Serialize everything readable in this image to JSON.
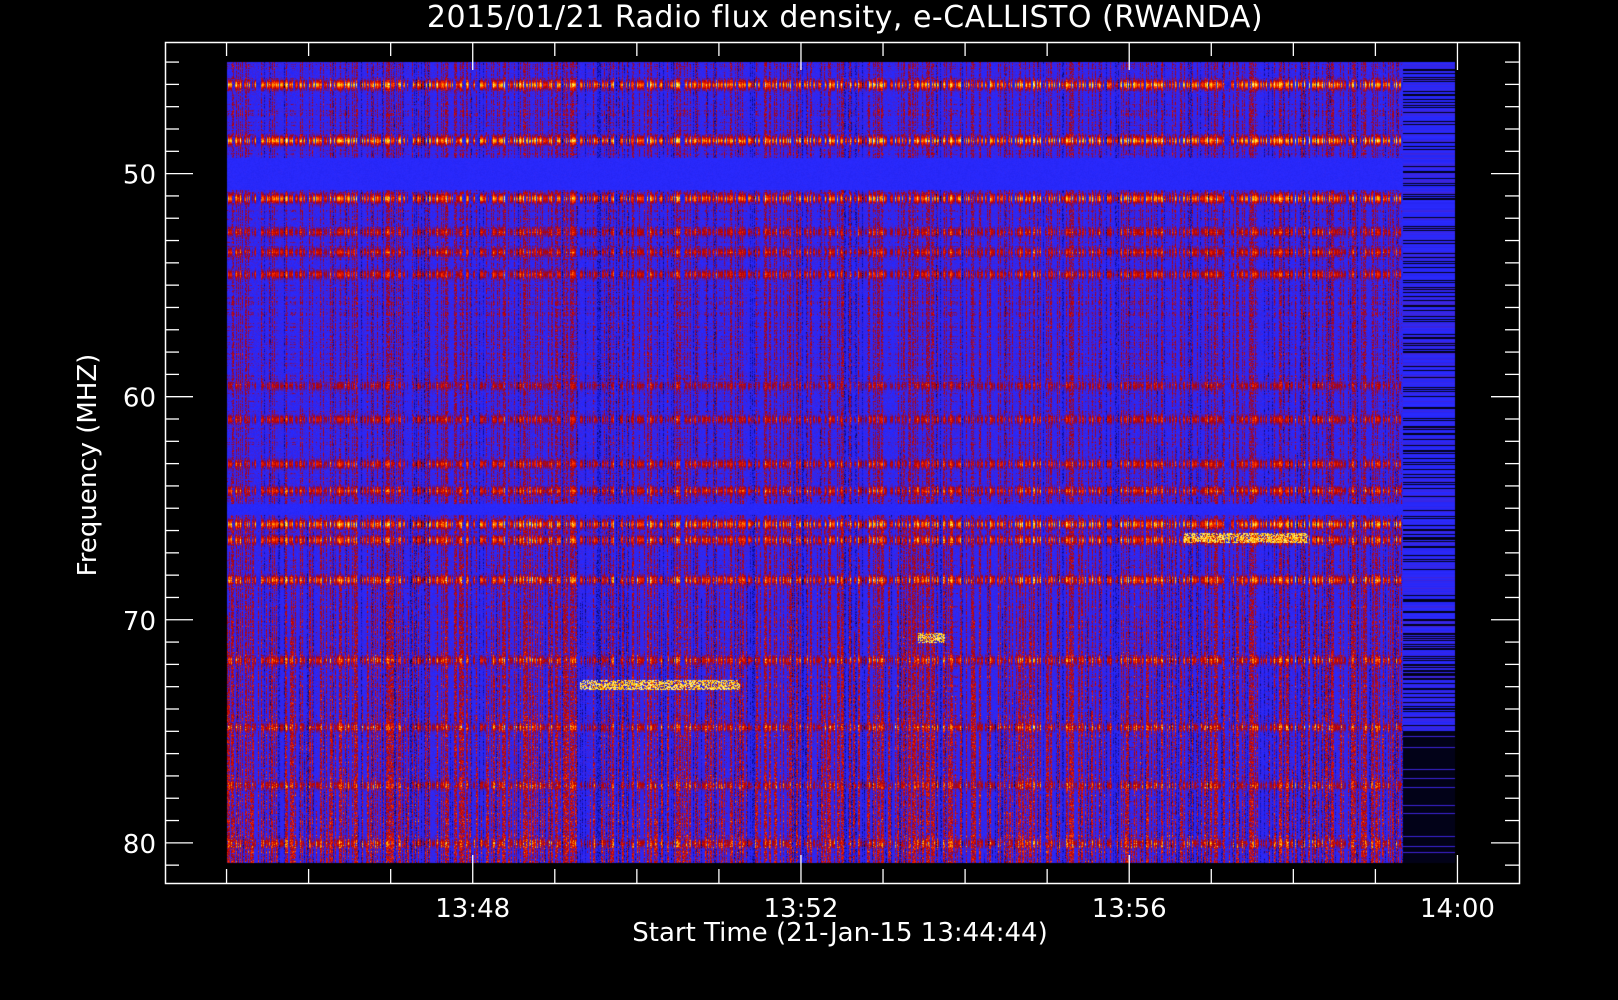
{
  "chart_data": {
    "type": "heatmap",
    "title": "2015/01/21  Radio flux density, e-CALLISTO (RWANDA)",
    "xlabel": "Start Time (21-Jan-15 13:44:44)",
    "ylabel": "Frequency (MHZ)",
    "xlim": [
      "13:44:15",
      "14:00:45"
    ],
    "ylim": [
      81.8,
      44.1
    ],
    "y_inverted": true,
    "x_ticks": [
      "13:48",
      "13:52",
      "13:56",
      "14:00"
    ],
    "x_minor_step_minutes": 1,
    "y_ticks": [
      50,
      60,
      70,
      80
    ],
    "y_minor_step_mhz": 1,
    "data_time_range": [
      "13:45:00",
      "13:59:20"
    ],
    "sparse_time_range": [
      "13:59:20",
      "14:00:00"
    ],
    "data_freq_range": [
      45.0,
      80.9
    ],
    "colormap": [
      "#000000",
      "#1414c8",
      "#2a2aff",
      "#b00000",
      "#ff2a00",
      "#ffd000",
      "#ffffc0"
    ],
    "bands": [
      {
        "freq": 46.0,
        "intensity": 0.9
      },
      {
        "freq": 48.5,
        "intensity": 0.9
      },
      {
        "freq": 51.1,
        "intensity": 0.85
      },
      {
        "freq": 52.6,
        "intensity": 0.45
      },
      {
        "freq": 53.5,
        "intensity": 0.5
      },
      {
        "freq": 54.5,
        "intensity": 0.55
      },
      {
        "freq": 59.5,
        "intensity": 0.35
      },
      {
        "freq": 61.0,
        "intensity": 0.5
      },
      {
        "freq": 63.0,
        "intensity": 0.55
      },
      {
        "freq": 64.2,
        "intensity": 0.55
      },
      {
        "freq": 65.7,
        "intensity": 0.85
      },
      {
        "freq": 66.4,
        "intensity": 0.7
      },
      {
        "freq": 68.2,
        "intensity": 0.7
      },
      {
        "freq": 71.8,
        "intensity": 0.55
      },
      {
        "freq": 74.8,
        "intensity": 0.45
      },
      {
        "freq": 77.4,
        "intensity": 0.4
      },
      {
        "freq": 80.0,
        "intensity": 0.45
      }
    ],
    "quiet_bands": [
      {
        "from": 49.3,
        "to": 50.7
      },
      {
        "from": 64.8,
        "to": 65.3
      }
    ],
    "bursts": [
      {
        "freq": 72.9,
        "start": "13:49:18",
        "end": "13:51:15",
        "intensity": 1.0
      },
      {
        "freq": 70.8,
        "start": "13:53:25",
        "end": "13:53:45",
        "intensity": 1.0
      },
      {
        "freq": 66.3,
        "start": "13:56:40",
        "end": "13:58:10",
        "intensity": 0.9
      }
    ]
  }
}
